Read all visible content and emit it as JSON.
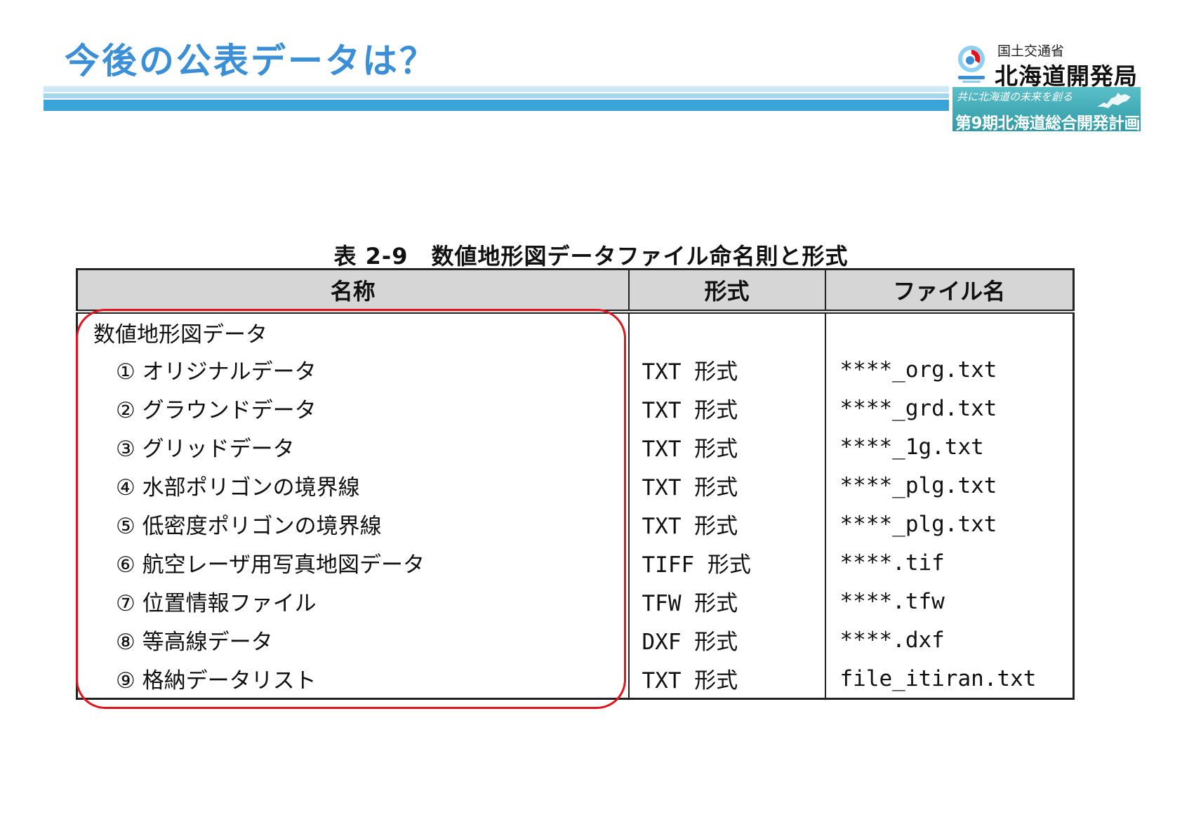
{
  "header": {
    "title": "今後の公表データは？"
  },
  "logo": {
    "ministry": "国土交通省",
    "bureau": "北海道開発局",
    "plan_slogan": "共に北海道の未来を創る",
    "plan_title": "第9期北海道総合開発計画"
  },
  "table": {
    "caption": "表 2-9　数値地形図データファイル命名則と形式",
    "headers": [
      "名称",
      "形式",
      "ファイル名"
    ],
    "group_label": "数値地形図データ",
    "rows": [
      {
        "name": "① オリジナルデータ",
        "format": "TXT 形式",
        "file": "****_org.txt"
      },
      {
        "name": "② グラウンドデータ",
        "format": "TXT 形式",
        "file": "****_grd.txt"
      },
      {
        "name": "③ グリッドデータ",
        "format": "TXT 形式",
        "file": "****_1g.txt"
      },
      {
        "name": "④ 水部ポリゴンの境界線",
        "format": "TXT 形式",
        "file": "****_plg.txt"
      },
      {
        "name": "⑤ 低密度ポリゴンの境界線",
        "format": "TXT 形式",
        "file": "****_plg.txt"
      },
      {
        "name": "⑥ 航空レーザ用写真地図データ",
        "format": "TIFF 形式",
        "file": "****.tif"
      },
      {
        "name": "⑦ 位置情報ファイル",
        "format": "TFW 形式",
        "file": "****.tfw"
      },
      {
        "name": "⑧ 等高線データ",
        "format": "DXF 形式",
        "file": "****.dxf"
      },
      {
        "name": "⑨ 格納データリスト",
        "format": "TXT 形式",
        "file": "file_itiran.txt"
      }
    ]
  },
  "colors": {
    "title": "#3b8fd6",
    "band": "#3aa3d8",
    "highlight": "#e0141f",
    "badge": "#2f9aa6"
  }
}
